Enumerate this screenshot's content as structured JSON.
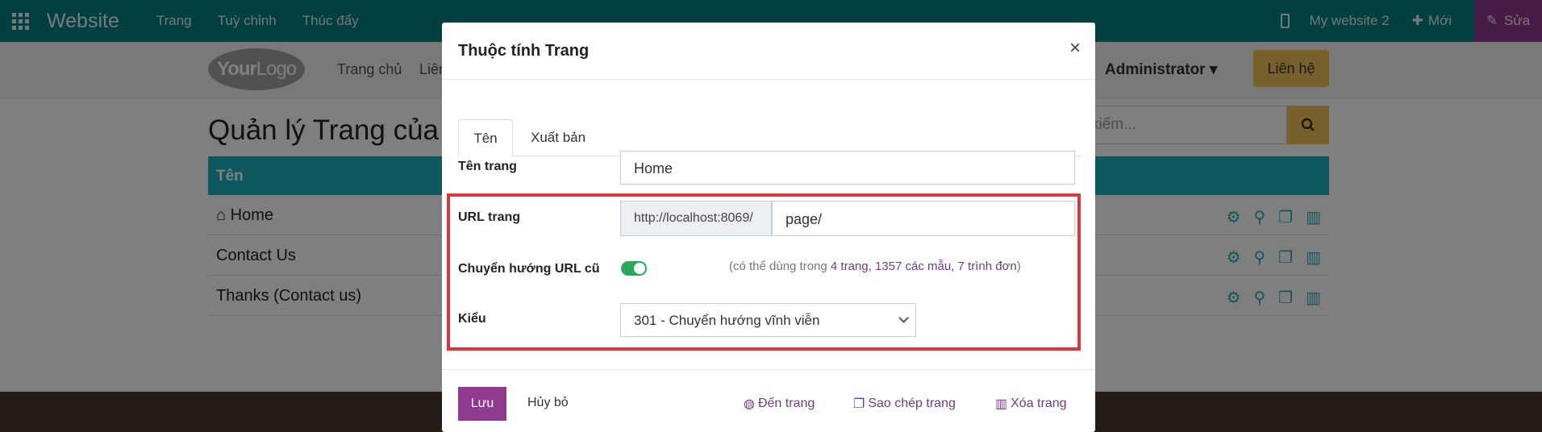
{
  "topbar": {
    "brand": "Website",
    "menu": [
      "Trang",
      "Tuỳ chỉnh",
      "Thúc đẩy"
    ],
    "site_name": "My website 2",
    "new_label": "Mới",
    "edit_label": "Sửa"
  },
  "site_header": {
    "logo_part1": "Your",
    "logo_part2": "Logo",
    "nav_home": "Trang chủ",
    "nav_partial": "Liên",
    "admin_label": "Administrator",
    "contact_label": "Liên hệ"
  },
  "page": {
    "title": "Quản lý Trang của b",
    "search_placeholder": "kiếm...",
    "table_header": "Tên",
    "rows": [
      {
        "name": "Home"
      },
      {
        "name": "Contact Us"
      },
      {
        "name": "Thanks (Contact us)"
      }
    ]
  },
  "modal": {
    "title": "Thuộc tính Trang",
    "close": "×",
    "tabs": [
      "Tên",
      "Xuất bản"
    ],
    "page_name_label": "Tên trang",
    "page_name_value": "Home",
    "url_label": "URL trang",
    "url_prefix": "http://localhost:8069/",
    "url_value": "page/",
    "redirect_label": "Chuyển hướng URL cũ",
    "redirect_enabled": true,
    "redirect_note_prefix": "(có thể dùng trong ",
    "redirect_note_links": "4 trang, 1357 các mẫu, 7 trình đơn",
    "redirect_note_suffix": ")",
    "type_label": "Kiểu",
    "type_value": "301 - Chuyển hướng vĩnh viễn",
    "save_label": "Lưu",
    "cancel_label": "Hủy bỏ",
    "goto_label": "Đến trang",
    "clone_label": "Sao chép trang",
    "delete_label": "Xóa trang"
  },
  "colors": {
    "topbar": "#017e84",
    "accent_purple": "#8f3a8f",
    "table_header": "#1bb3bb",
    "highlight_frame": "#d9363e",
    "toggle_on": "#27a85a"
  }
}
